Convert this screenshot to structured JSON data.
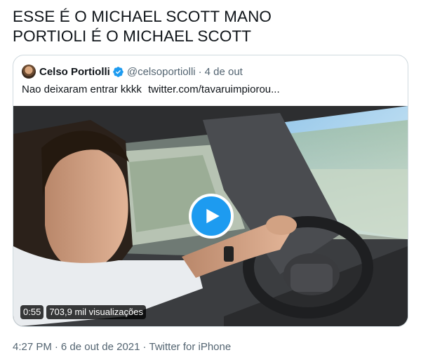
{
  "tweet": {
    "text_line1": "ESSE É O MICHAEL SCOTT MANO",
    "text_line2": "PORTIOLI É O MICHAEL SCOTT"
  },
  "quoted_tweet": {
    "author_name": "Celso Portiolli",
    "handle": "@celsoportiolli",
    "separator": "·",
    "date": "4 de out",
    "text": "Nao deixaram entrar kkkk",
    "link": "twitter.com/tavaruimpiorou...",
    "verified_icon": "verified-badge-icon",
    "verified_color": "#1d9bf0",
    "video": {
      "duration": "0:55",
      "views": "703,9 mil visualizações",
      "play_icon": "play-icon",
      "play_color": "#1d9bf0"
    }
  },
  "meta": {
    "time": "4:27 PM",
    "separator1": "·",
    "date": "6 de out de 2021",
    "separator2": "·",
    "source": "Twitter for iPhone"
  }
}
